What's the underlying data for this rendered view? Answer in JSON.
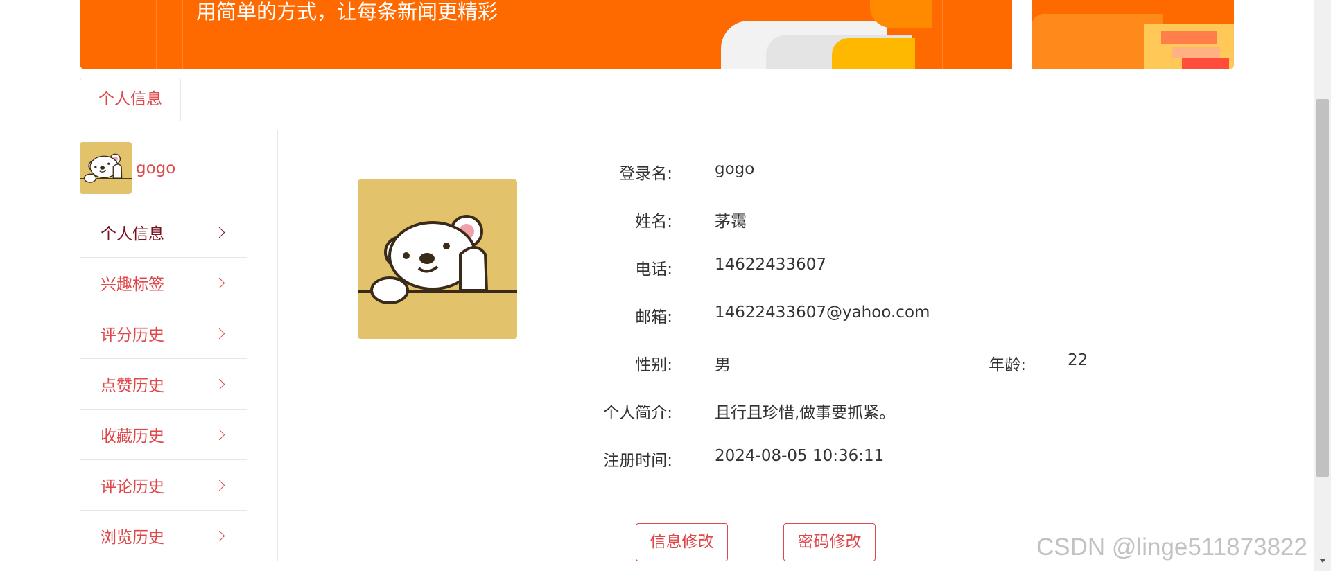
{
  "banner": {
    "slogan": "用简单的方式，让每条新闻更精彩"
  },
  "tabs": [
    {
      "label": "个人信息"
    }
  ],
  "user": {
    "username": "gogo"
  },
  "sidebar": {
    "items": [
      {
        "label": "个人信息",
        "active": true
      },
      {
        "label": "兴趣标签"
      },
      {
        "label": "评分历史"
      },
      {
        "label": "点赞历史"
      },
      {
        "label": "收藏历史"
      },
      {
        "label": "评论历史"
      },
      {
        "label": "浏览历史"
      }
    ]
  },
  "profile": {
    "fields": {
      "login": {
        "label": "登录名:",
        "value": "gogo"
      },
      "name": {
        "label": "姓名:",
        "value": "茅霭"
      },
      "phone": {
        "label": "电话:",
        "value": "14622433607"
      },
      "email": {
        "label": "邮箱:",
        "value": "14622433607@yahoo.com"
      },
      "gender": {
        "label": "性别:",
        "value": "男"
      },
      "age": {
        "label": "年龄:",
        "value": "22"
      },
      "bio": {
        "label": "个人简介:",
        "value": "且行且珍惜,做事要抓紧。"
      },
      "registered": {
        "label": "注册时间:",
        "value": "2024-08-05 10:36:11"
      }
    }
  },
  "actions": {
    "edit_info": "信息修改",
    "change_password": "密码修改"
  },
  "watermark": "CSDN @linge511873822",
  "icons": {
    "chevron": "chevron-right-icon",
    "avatar": "polar-bear-avatar"
  },
  "colors": {
    "brand_orange": "#ff6a00",
    "accent_red": "#e0474a",
    "active_text": "#7a1020",
    "avatar_bg": "#e2c26a"
  }
}
